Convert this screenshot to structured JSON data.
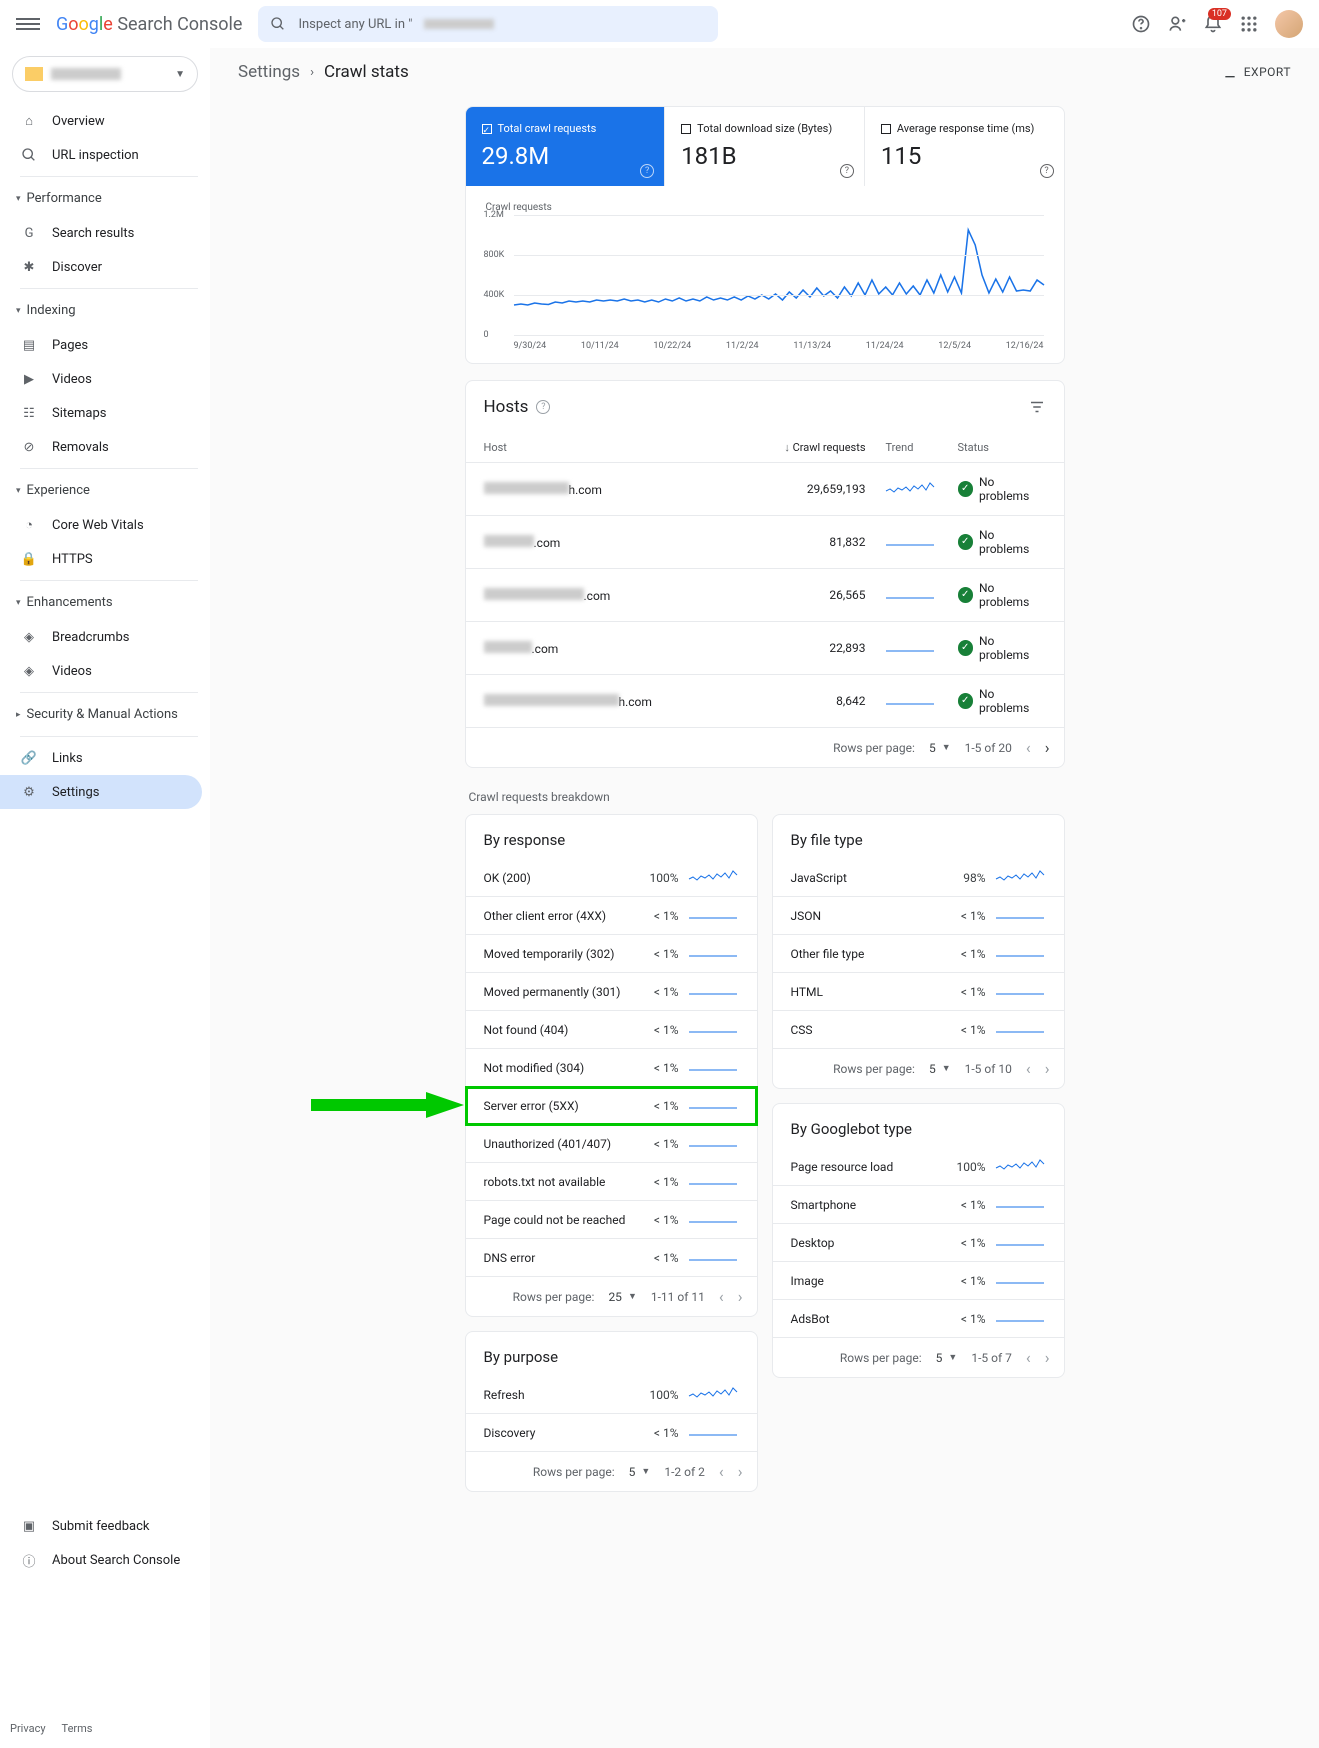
{
  "header": {
    "logo_text": "Search Console",
    "search_placeholder": "Inspect any URL in \"",
    "notification_count": "107"
  },
  "sidebar": {
    "overview": "Overview",
    "url_inspection": "URL inspection",
    "performance": "Performance",
    "search_results": "Search results",
    "discover": "Discover",
    "indexing": "Indexing",
    "pages": "Pages",
    "videos": "Videos",
    "sitemaps": "Sitemaps",
    "removals": "Removals",
    "experience": "Experience",
    "core_web_vitals": "Core Web Vitals",
    "https": "HTTPS",
    "enhancements": "Enhancements",
    "breadcrumbs": "Breadcrumbs",
    "videos2": "Videos",
    "security": "Security & Manual Actions",
    "links": "Links",
    "settings": "Settings",
    "submit_feedback": "Submit feedback",
    "about": "About Search Console",
    "privacy": "Privacy",
    "terms": "Terms"
  },
  "breadcrumb": {
    "settings": "Settings",
    "crawl_stats": "Crawl stats",
    "export": "EXPORT"
  },
  "stats": [
    {
      "label": "Total crawl requests",
      "value": "29.8M"
    },
    {
      "label": "Total download size (Bytes)",
      "value": "181B"
    },
    {
      "label": "Average response time (ms)",
      "value": "115"
    }
  ],
  "chart_data": {
    "type": "line",
    "title": "Crawl requests",
    "ylabel": "",
    "xlabel": "",
    "ylim": [
      0,
      1200000
    ],
    "y_ticks": [
      "1.2M",
      "800K",
      "400K",
      "0"
    ],
    "x_ticks": [
      "9/30/24",
      "10/11/24",
      "10/22/24",
      "11/2/24",
      "11/13/24",
      "11/24/24",
      "12/5/24",
      "12/16/24"
    ],
    "x": [
      0,
      1,
      2,
      3,
      4,
      5,
      6,
      7,
      8,
      9,
      10,
      11,
      12,
      13,
      14,
      15,
      16,
      17,
      18,
      19,
      20,
      21,
      22,
      23,
      24,
      25,
      26,
      27,
      28,
      29,
      30,
      31,
      32,
      33,
      34,
      35,
      36,
      37,
      38,
      39,
      40,
      41,
      42,
      43,
      44,
      45,
      46,
      47,
      48,
      49,
      50,
      51,
      52,
      53,
      54,
      55,
      56,
      57,
      58,
      59,
      60,
      61,
      62,
      63,
      64,
      65,
      66,
      67,
      68,
      69,
      70,
      71,
      72,
      73,
      74,
      75,
      76,
      77
    ],
    "values": [
      300000,
      310000,
      300000,
      320000,
      310000,
      305000,
      330000,
      320000,
      340000,
      330000,
      340000,
      330000,
      350000,
      340000,
      350000,
      340000,
      360000,
      340000,
      350000,
      330000,
      350000,
      330000,
      360000,
      340000,
      370000,
      340000,
      360000,
      340000,
      380000,
      350000,
      370000,
      350000,
      380000,
      350000,
      390000,
      360000,
      400000,
      360000,
      410000,
      350000,
      430000,
      370000,
      450000,
      380000,
      470000,
      390000,
      440000,
      370000,
      480000,
      390000,
      520000,
      400000,
      550000,
      410000,
      480000,
      400000,
      520000,
      410000,
      490000,
      400000,
      550000,
      420000,
      600000,
      430000,
      580000,
      420000,
      1050000,
      900000,
      600000,
      420000,
      560000,
      430000,
      580000,
      440000,
      450000,
      440000,
      550000,
      500000
    ]
  },
  "hosts": {
    "title": "Hosts",
    "columns": {
      "host": "Host",
      "requests": "Crawl requests",
      "trend": "Trend",
      "status": "Status"
    },
    "rows": [
      {
        "suffix": "h.com",
        "blur_width": 85,
        "requests": "29,659,193",
        "status": "No problems"
      },
      {
        "suffix": ".com",
        "blur_width": 50,
        "requests": "81,832",
        "status": "No problems"
      },
      {
        "suffix": ".com",
        "blur_width": 100,
        "requests": "26,565",
        "status": "No problems"
      },
      {
        "suffix": ".com",
        "blur_width": 48,
        "requests": "22,893",
        "status": "No problems"
      },
      {
        "suffix": "h.com",
        "blur_width": 135,
        "requests": "8,642",
        "status": "No problems"
      }
    ],
    "pager": {
      "rows_label": "Rows per page:",
      "rows_value": "5",
      "range": "1-5 of 20"
    }
  },
  "breakdown_title": "Crawl requests breakdown",
  "by_response": {
    "title": "By response",
    "rows": [
      {
        "label": "OK (200)",
        "pct": "100%",
        "spark": "noisy"
      },
      {
        "label": "Other client error (4XX)",
        "pct": "< 1%"
      },
      {
        "label": "Moved temporarily (302)",
        "pct": "< 1%"
      },
      {
        "label": "Moved permanently (301)",
        "pct": "< 1%"
      },
      {
        "label": "Not found (404)",
        "pct": "< 1%"
      },
      {
        "label": "Not modified (304)",
        "pct": "< 1%"
      },
      {
        "label": "Server error (5XX)",
        "pct": "< 1%",
        "highlight": true
      },
      {
        "label": "Unauthorized (401/407)",
        "pct": "< 1%"
      },
      {
        "label": "robots.txt not available",
        "pct": "< 1%"
      },
      {
        "label": "Page could not be reached",
        "pct": "< 1%"
      },
      {
        "label": "DNS error",
        "pct": "< 1%"
      }
    ],
    "pager": {
      "rows_label": "Rows per page:",
      "rows_value": "25",
      "range": "1-11 of 11"
    }
  },
  "by_file_type": {
    "title": "By file type",
    "rows": [
      {
        "label": "JavaScript",
        "pct": "98%",
        "spark": "noisy"
      },
      {
        "label": "JSON",
        "pct": "< 1%"
      },
      {
        "label": "Other file type",
        "pct": "< 1%"
      },
      {
        "label": "HTML",
        "pct": "< 1%"
      },
      {
        "label": "CSS",
        "pct": "< 1%"
      }
    ],
    "pager": {
      "rows_label": "Rows per page:",
      "rows_value": "5",
      "range": "1-5 of 10"
    }
  },
  "by_googlebot": {
    "title": "By Googlebot type",
    "rows": [
      {
        "label": "Page resource load",
        "pct": "100%",
        "spark": "noisy"
      },
      {
        "label": "Smartphone",
        "pct": "< 1%"
      },
      {
        "label": "Desktop",
        "pct": "< 1%"
      },
      {
        "label": "Image",
        "pct": "< 1%"
      },
      {
        "label": "AdsBot",
        "pct": "< 1%"
      }
    ],
    "pager": {
      "rows_label": "Rows per page:",
      "rows_value": "5",
      "range": "1-5 of 7"
    }
  },
  "by_purpose": {
    "title": "By purpose",
    "rows": [
      {
        "label": "Refresh",
        "pct": "100%",
        "spark": "noisy"
      },
      {
        "label": "Discovery",
        "pct": "< 1%"
      }
    ],
    "pager": {
      "rows_label": "Rows per page:",
      "rows_value": "5",
      "range": "1-2 of 2"
    }
  }
}
